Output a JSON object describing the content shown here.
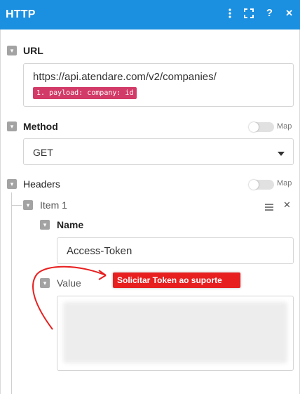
{
  "header": {
    "title": "HTTP",
    "bg_color": "#1b8fe0",
    "tools": [
      {
        "name": "kebab-menu-icon",
        "glyph": "⋮"
      },
      {
        "name": "expand-icon",
        "glyph": "⤢"
      },
      {
        "name": "help-icon",
        "glyph": "?"
      },
      {
        "name": "close-icon",
        "glyph": "✕"
      }
    ]
  },
  "url_section": {
    "label": "URL",
    "value": "https://api.atendare.com/v2/companies/",
    "token": "1. payload: company: id",
    "token_color": "#d23a67"
  },
  "method_section": {
    "label": "Method",
    "map_label": "Map",
    "map_enabled": false,
    "value": "GET"
  },
  "headers_section": {
    "label": "Headers",
    "map_label": "Map",
    "map_enabled": false,
    "item": {
      "label": "Item 1",
      "name_label": "Name",
      "name_value": "Access-Token",
      "value_label": "Value",
      "annotation": "Solicitar Token ao suporte",
      "annotation_color": "#e81f1f"
    }
  }
}
